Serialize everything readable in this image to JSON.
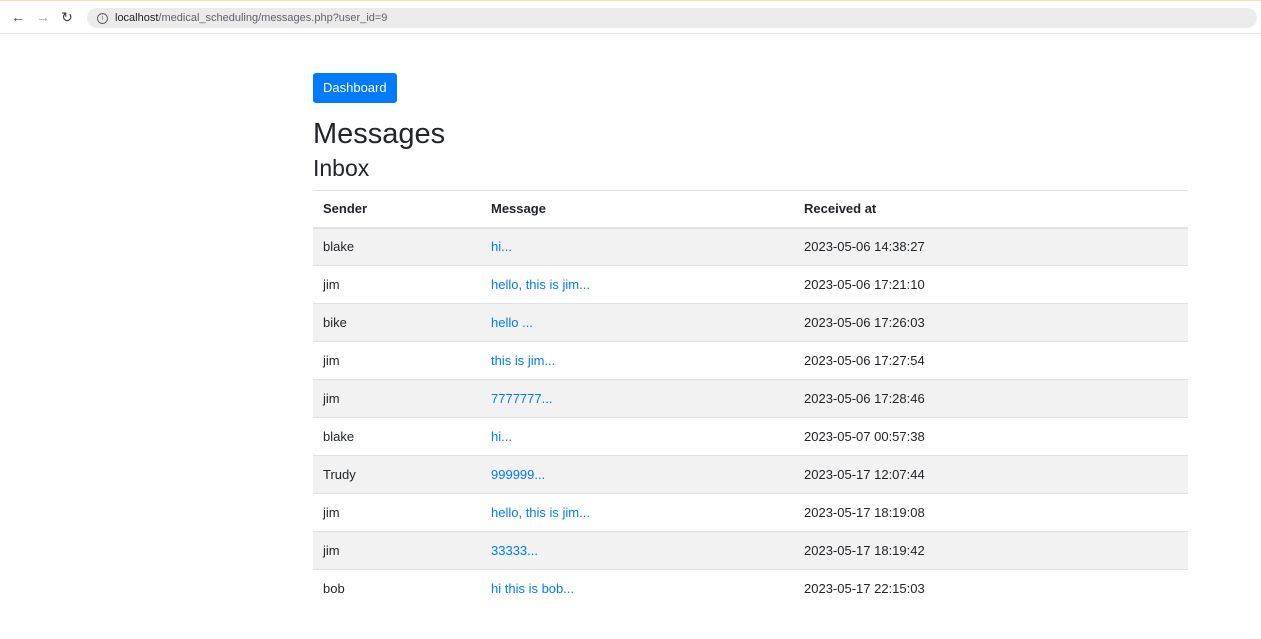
{
  "browser": {
    "url_host": "localhost",
    "url_path": "/medical_scheduling/messages.php?user_id=9",
    "back_icon": "arrow-left-icon",
    "forward_icon": "arrow-right-icon",
    "reload_icon": "reload-icon",
    "info_icon": "info-icon"
  },
  "page": {
    "dashboard_button": "Dashboard",
    "title": "Messages",
    "inbox_title": "Inbox",
    "accent_color": "#007bff"
  },
  "inbox": {
    "headers": [
      "Sender",
      "Message",
      "Received at"
    ],
    "rows": [
      {
        "sender": "blake",
        "message": "hi...",
        "received_at": "2023-05-06 14:38:27"
      },
      {
        "sender": "jim",
        "message": "hello, this is jim...",
        "received_at": "2023-05-06 17:21:10"
      },
      {
        "sender": "bike",
        "message": "hello ...",
        "received_at": "2023-05-06 17:26:03"
      },
      {
        "sender": "jim",
        "message": "this is jim...",
        "received_at": "2023-05-06 17:27:54"
      },
      {
        "sender": "jim",
        "message": "7777777...",
        "received_at": "2023-05-06 17:28:46"
      },
      {
        "sender": "blake",
        "message": "hi...",
        "received_at": "2023-05-07 00:57:38"
      },
      {
        "sender": "Trudy",
        "message": "999999...",
        "received_at": "2023-05-17 12:07:44"
      },
      {
        "sender": "jim",
        "message": "hello, this is jim...",
        "received_at": "2023-05-17 18:19:08"
      },
      {
        "sender": "jim",
        "message": "33333...",
        "received_at": "2023-05-17 18:19:42"
      },
      {
        "sender": "bob",
        "message": "hi this is bob...",
        "received_at": "2023-05-17 22:15:03"
      }
    ]
  }
}
